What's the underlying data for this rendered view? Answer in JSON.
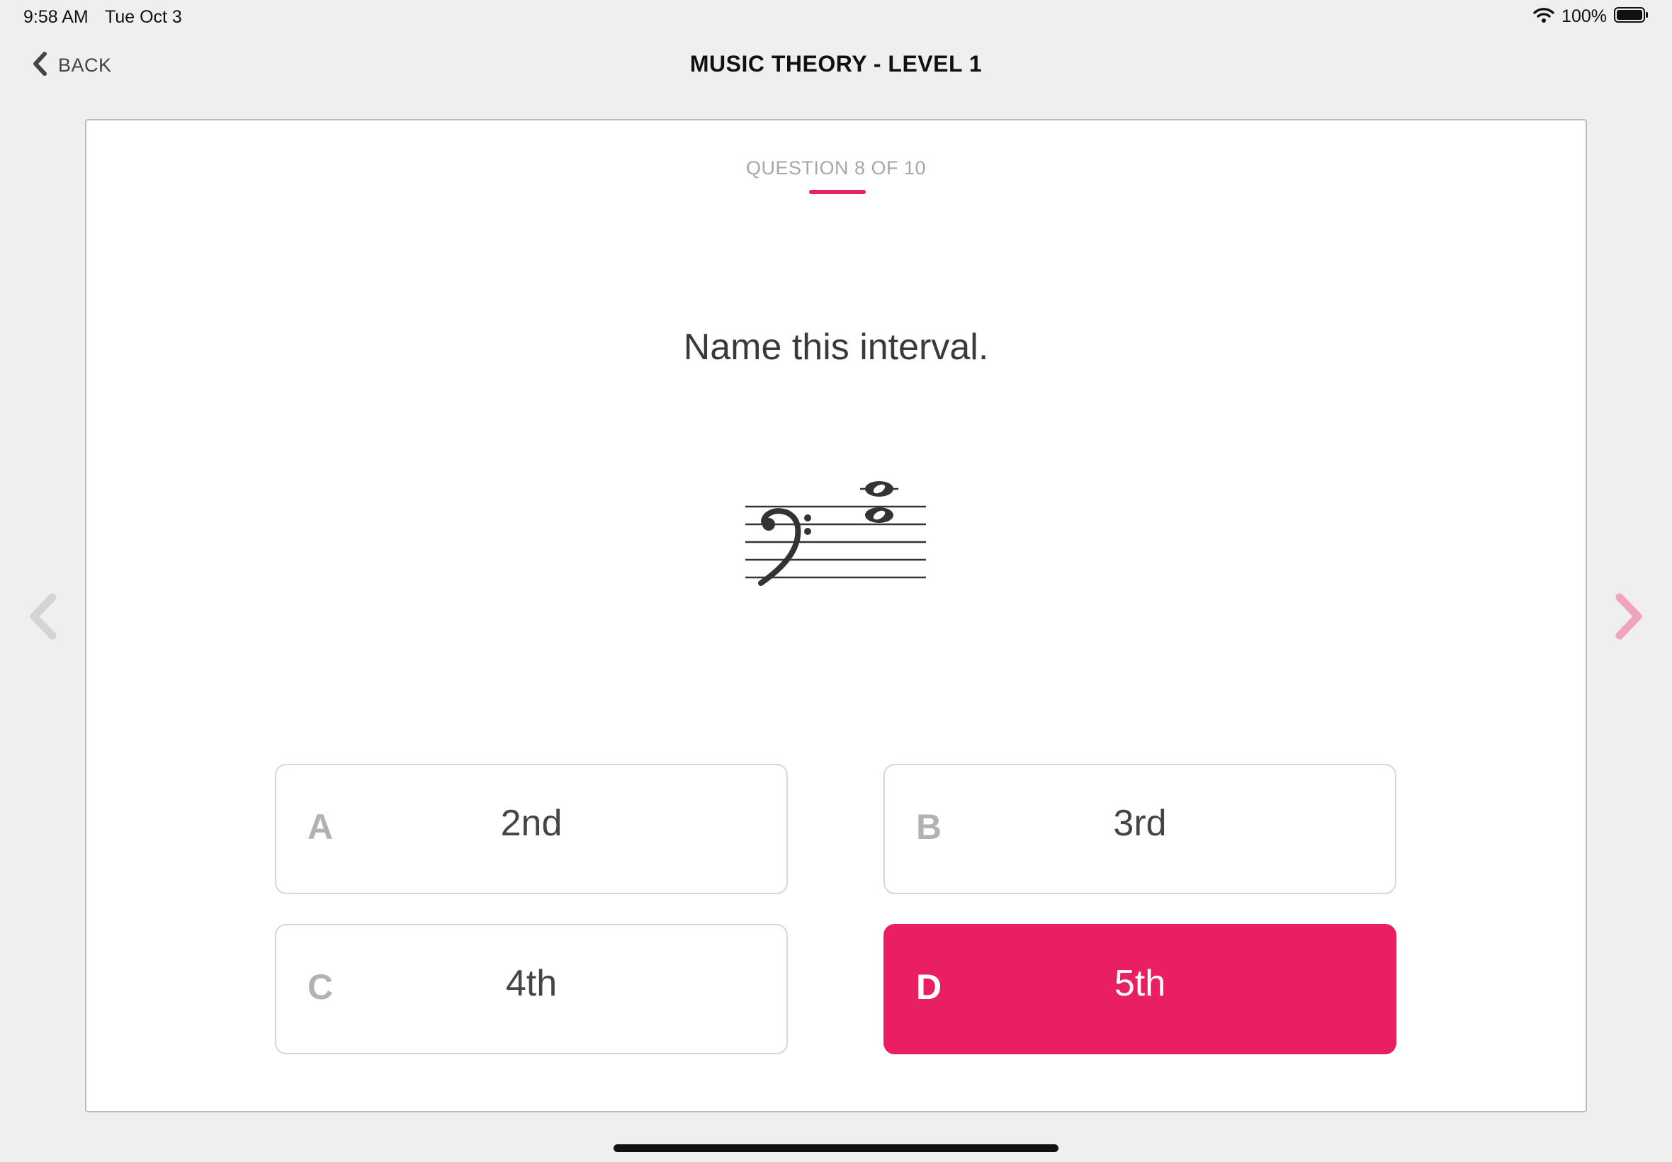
{
  "status_bar": {
    "time": "9:58 AM",
    "date": "Tue Oct 3",
    "battery": "100%"
  },
  "nav": {
    "back_label": "BACK",
    "title": "MUSIC THEORY - LEVEL 1"
  },
  "quiz": {
    "counter": "QUESTION 8 OF 10",
    "question": "Name this interval.",
    "notation": {
      "clef": "bass",
      "notes": [
        "C4",
        "G3"
      ]
    },
    "answers": [
      {
        "letter": "A",
        "value": "2nd",
        "selected": false
      },
      {
        "letter": "B",
        "value": "3rd",
        "selected": false
      },
      {
        "letter": "C",
        "value": "4th",
        "selected": false
      },
      {
        "letter": "D",
        "value": "5th",
        "selected": true
      }
    ]
  },
  "colors": {
    "accent": "#e91e63",
    "next_arrow": "#f0a5bf",
    "prev_arrow": "#d4d4d4"
  }
}
